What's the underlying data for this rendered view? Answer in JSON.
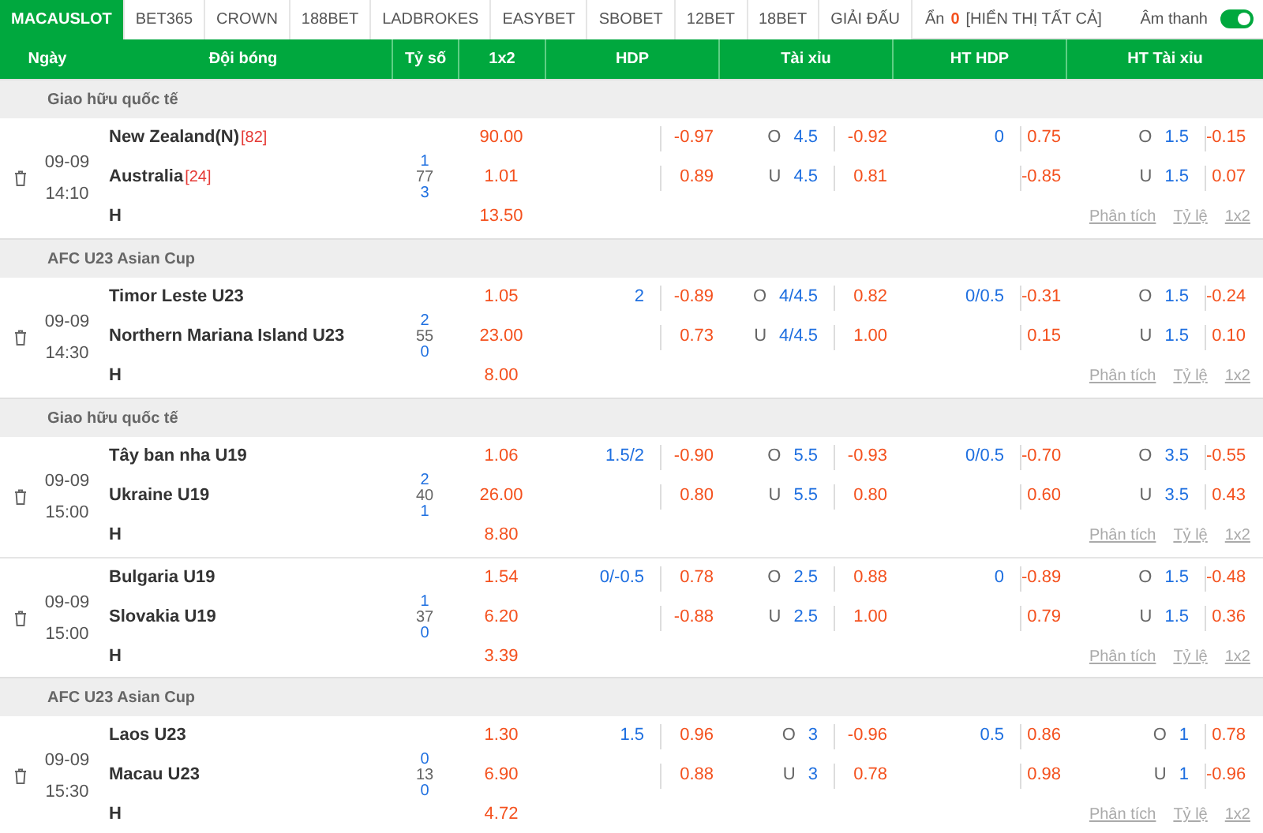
{
  "bookmakers": [
    {
      "label": "MACAUSLOT",
      "selected": true
    },
    {
      "label": "BET365",
      "selected": false
    },
    {
      "label": "CROWN",
      "selected": false
    },
    {
      "label": "188BET",
      "selected": false
    },
    {
      "label": "LADBROKES",
      "selected": false
    },
    {
      "label": "EASYBET",
      "selected": false
    },
    {
      "label": "SBOBET",
      "selected": false
    },
    {
      "label": "12BET",
      "selected": false
    },
    {
      "label": "18BET",
      "selected": false
    },
    {
      "label": "GIẢI ĐẤU",
      "selected": false
    }
  ],
  "hidden": {
    "label": "Ẩn",
    "count": "0",
    "show_all": "[HIỂN THỊ TẤT CẢ]"
  },
  "sound": {
    "label": "Âm thanh",
    "on": true
  },
  "columns": [
    "Ngày",
    "Đội bóng",
    "Tỷ số",
    "1x2",
    "HDP",
    "Tài xỉu",
    "HT HDP",
    "HT Tài xỉu"
  ],
  "groups": [
    {
      "league": "Giao hữu quốc tế",
      "matches": [
        {
          "date": "09-09",
          "time": "14:10",
          "home": "New Zealand(N)",
          "home_rank": "[82]",
          "away": "Australia",
          "away_rank": "[24]",
          "draw": "H",
          "score": [
            "1",
            "77",
            "3"
          ],
          "x12": [
            "90.00",
            "1.01",
            "13.50"
          ],
          "hdp": [
            {
              "odds": "-0.97"
            },
            {
              "odds": "0.89"
            }
          ],
          "tx": [
            {
              "side": "O",
              "line": "4.5",
              "odds": "-0.92"
            },
            {
              "side": "U",
              "line": "4.5",
              "odds": "0.81"
            }
          ],
          "ht_hdp": [
            {
              "line": "0",
              "odds": "0.75"
            },
            {
              "odds": "-0.85"
            }
          ],
          "ht_tx": [
            {
              "side": "O",
              "line": "1.5",
              "odds": "-0.15"
            },
            {
              "side": "U",
              "line": "1.5",
              "odds": "0.07"
            }
          ],
          "links": [
            "Phân tích",
            "Tỷ lệ",
            "1x2"
          ]
        }
      ]
    },
    {
      "league": "AFC U23 Asian Cup",
      "matches": [
        {
          "date": "09-09",
          "time": "14:30",
          "home": "Timor Leste U23",
          "away": "Northern Mariana Island U23",
          "draw": "H",
          "score": [
            "2",
            "55",
            "0"
          ],
          "x12": [
            "1.05",
            "23.00",
            "8.00"
          ],
          "hdp": [
            {
              "line": "2",
              "odds": "-0.89"
            },
            {
              "odds": "0.73"
            }
          ],
          "tx": [
            {
              "side": "O",
              "line": "4/4.5",
              "odds": "0.82"
            },
            {
              "side": "U",
              "line": "4/4.5",
              "odds": "1.00"
            }
          ],
          "ht_hdp": [
            {
              "line": "0/0.5",
              "odds": "-0.31"
            },
            {
              "odds": "0.15"
            }
          ],
          "ht_tx": [
            {
              "side": "O",
              "line": "1.5",
              "odds": "-0.24"
            },
            {
              "side": "U",
              "line": "1.5",
              "odds": "0.10"
            }
          ],
          "links": [
            "Phân tích",
            "Tỷ lệ",
            "1x2"
          ]
        }
      ]
    },
    {
      "league": "Giao hữu quốc tế",
      "matches": [
        {
          "date": "09-09",
          "time": "15:00",
          "home": "Tây ban nha U19",
          "away": "Ukraine U19",
          "draw": "H",
          "score": [
            "2",
            "40",
            "1"
          ],
          "x12": [
            "1.06",
            "26.00",
            "8.80"
          ],
          "hdp": [
            {
              "line": "1.5/2",
              "odds": "-0.90"
            },
            {
              "odds": "0.80"
            }
          ],
          "tx": [
            {
              "side": "O",
              "line": "5.5",
              "odds": "-0.93"
            },
            {
              "side": "U",
              "line": "5.5",
              "odds": "0.80"
            }
          ],
          "ht_hdp": [
            {
              "line": "0/0.5",
              "odds": "-0.70"
            },
            {
              "odds": "0.60"
            }
          ],
          "ht_tx": [
            {
              "side": "O",
              "line": "3.5",
              "odds": "-0.55"
            },
            {
              "side": "U",
              "line": "3.5",
              "odds": "0.43"
            }
          ],
          "links": [
            "Phân tích",
            "Tỷ lệ",
            "1x2"
          ]
        },
        {
          "date": "09-09",
          "time": "15:00",
          "home": "Bulgaria U19",
          "away": "Slovakia U19",
          "draw": "H",
          "score": [
            "1",
            "37",
            "0"
          ],
          "x12": [
            "1.54",
            "6.20",
            "3.39"
          ],
          "hdp": [
            {
              "line": "0/-0.5",
              "odds": "0.78"
            },
            {
              "odds": "-0.88"
            }
          ],
          "tx": [
            {
              "side": "O",
              "line": "2.5",
              "odds": "0.88"
            },
            {
              "side": "U",
              "line": "2.5",
              "odds": "1.00"
            }
          ],
          "ht_hdp": [
            {
              "line": "0",
              "odds": "-0.89"
            },
            {
              "odds": "0.79"
            }
          ],
          "ht_tx": [
            {
              "side": "O",
              "line": "1.5",
              "odds": "-0.48"
            },
            {
              "side": "U",
              "line": "1.5",
              "odds": "0.36"
            }
          ],
          "links": [
            "Phân tích",
            "Tỷ lệ",
            "1x2"
          ]
        }
      ]
    },
    {
      "league": "AFC U23 Asian Cup",
      "matches": [
        {
          "date": "09-09",
          "time": "15:30",
          "home": "Laos U23",
          "away": "Macau U23",
          "draw": "H",
          "score": [
            "0",
            "13",
            "0"
          ],
          "x12": [
            "1.30",
            "6.90",
            "4.72"
          ],
          "hdp": [
            {
              "line": "1.5",
              "odds": "0.96"
            },
            {
              "odds": "0.88"
            }
          ],
          "tx": [
            {
              "side": "O",
              "line": "3",
              "odds": "-0.96"
            },
            {
              "side": "U",
              "line": "3",
              "odds": "0.78"
            }
          ],
          "ht_hdp": [
            {
              "line": "0.5",
              "odds": "0.86"
            },
            {
              "odds": "0.98"
            }
          ],
          "ht_tx": [
            {
              "side": "O",
              "line": "1",
              "odds": "0.78"
            },
            {
              "side": "U",
              "line": "1",
              "odds": "-0.96"
            }
          ],
          "links": [
            "Phân tích",
            "Tỷ lệ",
            "1x2"
          ]
        }
      ]
    }
  ]
}
